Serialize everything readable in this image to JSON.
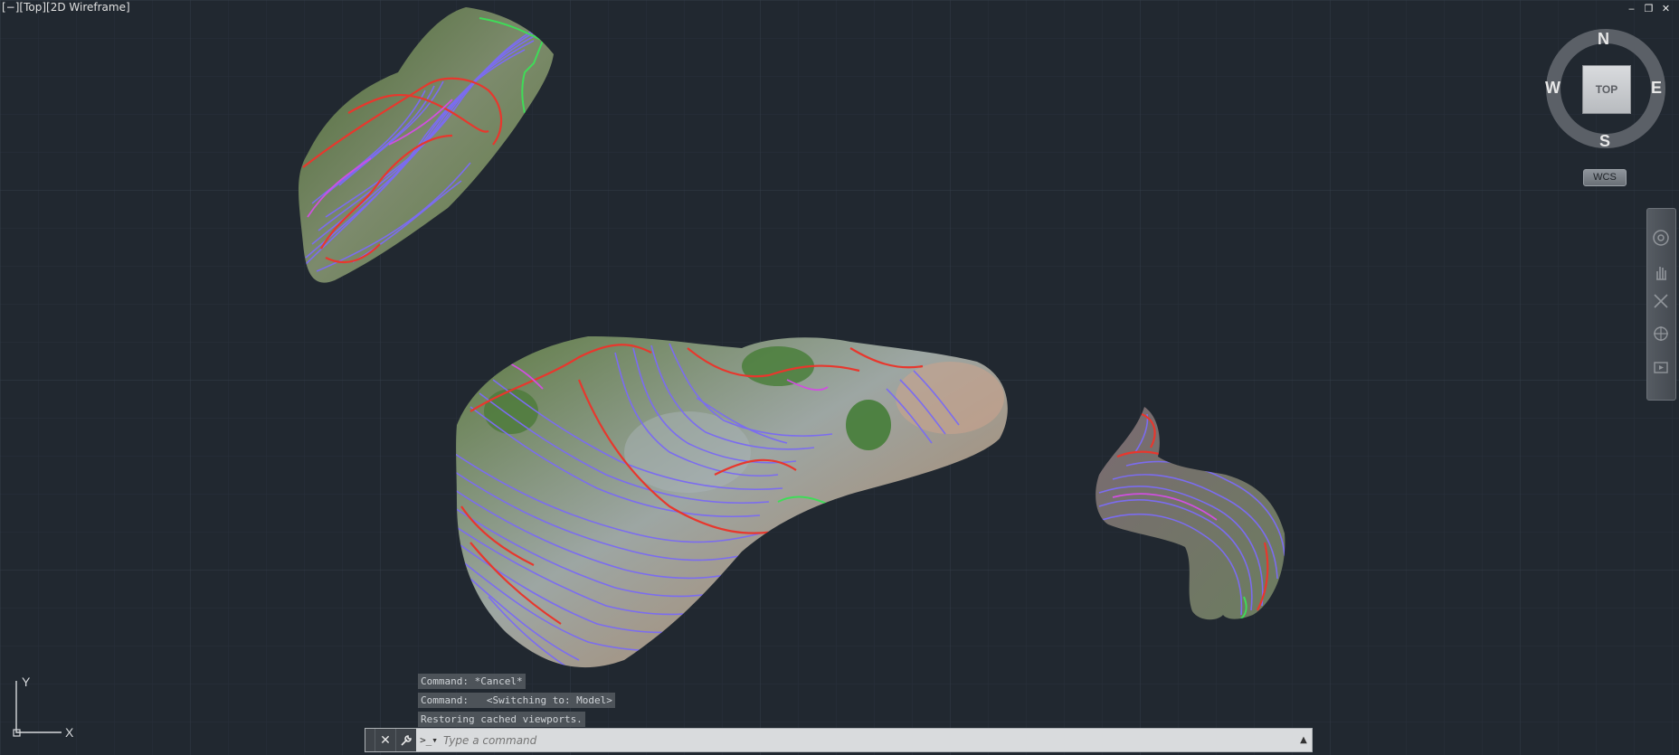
{
  "viewport": {
    "label": "[−][Top][2D Wireframe]"
  },
  "window_controls": [
    "‒",
    "❐",
    "✕"
  ],
  "viewcube": {
    "north": "N",
    "south": "S",
    "east": "E",
    "west": "W",
    "face": "TOP",
    "wcs": "WCS"
  },
  "navbar": {
    "tools": [
      "steering-wheel-icon",
      "pan-icon",
      "zoom-extents-icon",
      "orbit-icon",
      "showmotion-icon"
    ]
  },
  "command_history": [
    "Command: *Cancel*",
    "Command:   <Switching to: Model>",
    "Restoring cached viewports."
  ],
  "command_line": {
    "placeholder": "Type a command"
  },
  "ucs": {
    "x_label": "X",
    "y_label": "Y"
  },
  "colors": {
    "background": "#212830",
    "grid": "#2d3540",
    "contour_major": "#e8372d",
    "contour_minor": "#7b6cf0",
    "contour_highlight": "#d04fe0",
    "boundary": "#3fdc58"
  }
}
